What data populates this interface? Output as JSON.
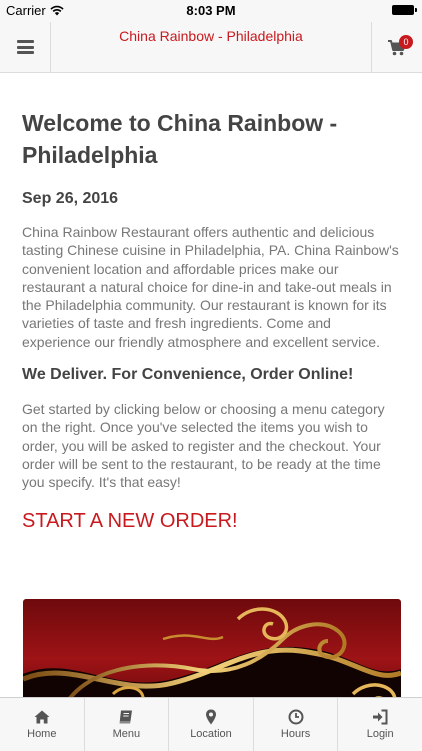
{
  "status_bar": {
    "carrier": "Carrier",
    "time": "8:03 PM"
  },
  "header": {
    "title": "China Rainbow - Philadelphia",
    "cart_count": "0"
  },
  "main": {
    "title": "Welcome to China Rainbow - Philadelphia",
    "date": "Sep 26, 2016",
    "intro": "China Rainbow Restaurant offers authentic and delicious tasting Chinese cuisine in Philadelphia, PA. China Rainbow's convenient location and affordable prices make our restaurant a natural choice for dine-in and take-out meals in the Philadelphia community. Our restaurant is known for its varieties of taste and fresh ingredients. Come and experience our friendly atmosphere and excellent service.",
    "deliver_heading": "We Deliver. For Convenience, Order Online!",
    "get_started": "Get started by clicking below or choosing a menu category on the right. Once you've selected the items you wish to order, you will be asked to register and the checkout. Your order will be sent to the restaurant, to be ready at the time you specify. It's that easy!",
    "start_order": "START A NEW ORDER!"
  },
  "tabs": [
    {
      "label": "Home",
      "icon": "home-icon"
    },
    {
      "label": "Menu",
      "icon": "book-icon"
    },
    {
      "label": "Location",
      "icon": "map-marker-icon"
    },
    {
      "label": "Hours",
      "icon": "clock-icon"
    },
    {
      "label": "Login",
      "icon": "sign-in-icon"
    }
  ],
  "colors": {
    "accent": "#c8191e",
    "banner_red": "#8a0f12",
    "banner_gold": "#d9a441"
  }
}
